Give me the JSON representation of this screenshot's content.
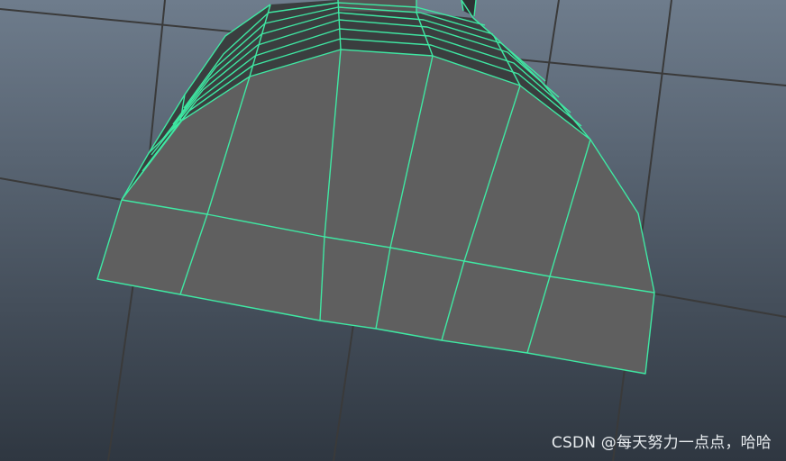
{
  "viewport": {
    "background_top": "#6e7c8c",
    "background_bottom": "#2f3741",
    "grid_color": "#3a3a3a",
    "wire_color": "#3fe8a3",
    "face_color": "#5f5f5f",
    "dark_face_color": "#3a3e3f"
  },
  "watermark": {
    "text": "CSDN @每天努力一点点，哈哈"
  }
}
